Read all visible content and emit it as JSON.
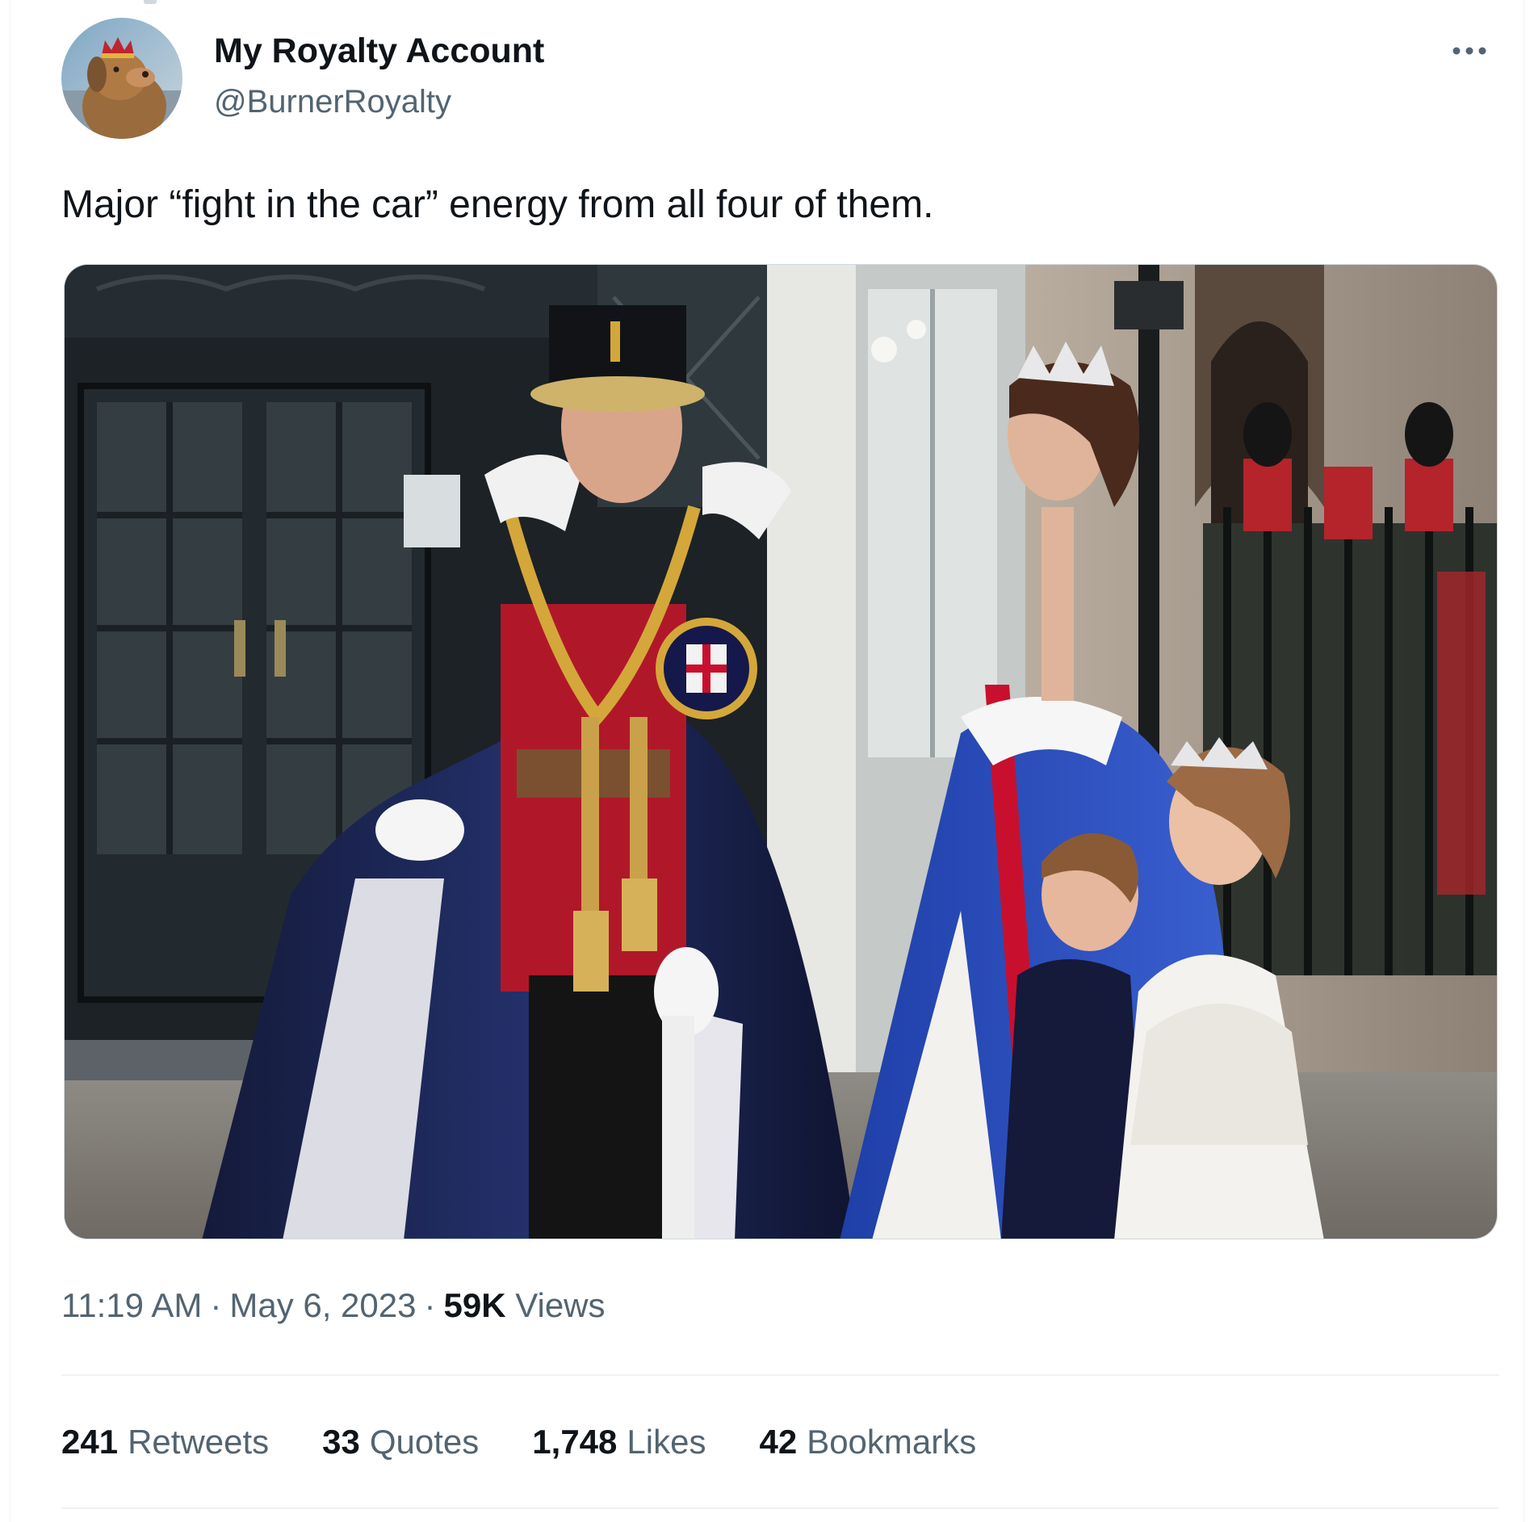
{
  "author": {
    "display_name": "My Royalty Account",
    "handle": "@BurnerRoyalty",
    "avatar": "royal-crowned-dog-avatar"
  },
  "more_icon": "more-horizontal-icon",
  "tweet": {
    "text": "Major “fight in the car” energy from all four of them."
  },
  "media": {
    "type": "photo",
    "subject": "royal family group photo"
  },
  "meta": {
    "time": "11:19 AM",
    "separator": "·",
    "date": "May 6, 2023",
    "views_count": "59K",
    "views_label": "Views"
  },
  "stats": {
    "retweets": {
      "count": "241",
      "label": "Retweets"
    },
    "quotes": {
      "count": "33",
      "label": "Quotes"
    },
    "likes": {
      "count": "1,748",
      "label": "Likes"
    },
    "bookmarks": {
      "count": "42",
      "label": "Bookmarks"
    }
  },
  "colors": {
    "text_primary": "#0f1419",
    "text_secondary": "#536471",
    "divider": "#eff3f4"
  }
}
